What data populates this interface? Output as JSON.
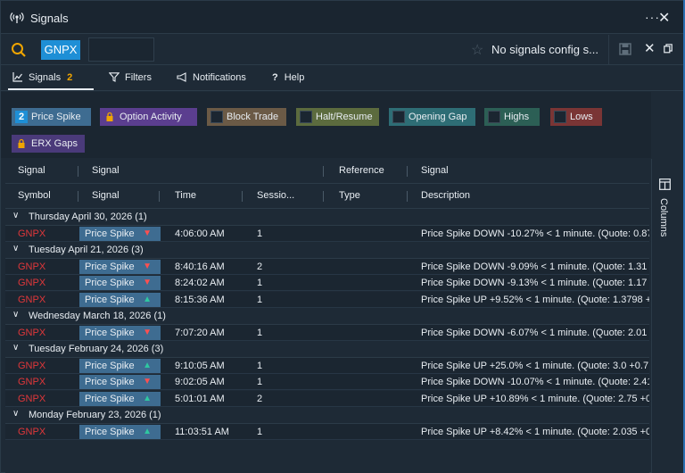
{
  "window": {
    "title": "Signals"
  },
  "search": {
    "symbol": "GNPX",
    "config_text": "No signals config s..."
  },
  "tabs": [
    {
      "label": "Signals",
      "count": "2"
    },
    {
      "label": "Filters"
    },
    {
      "label": "Notifications"
    },
    {
      "label": "Help"
    }
  ],
  "chips": [
    {
      "label": "Price Spike",
      "marker": "2",
      "bg": "#3e6c91",
      "state": "count"
    },
    {
      "label": "Option Activity",
      "bg": "#5b3e8f",
      "state": "locked"
    },
    {
      "label": "Block Trade",
      "bg": "#6b5a46",
      "state": "unchecked"
    },
    {
      "label": "Halt/Resume",
      "bg": "#5c6b3e",
      "state": "unchecked"
    },
    {
      "label": "Opening Gap",
      "bg": "#2e6d75",
      "state": "unchecked"
    },
    {
      "label": "Highs",
      "bg": "#2c5f55",
      "state": "unchecked"
    },
    {
      "label": "Lows",
      "bg": "#7a3535",
      "state": "unchecked"
    },
    {
      "label": "ERX Gaps",
      "bg": "#4a3a7a",
      "state": "locked"
    }
  ],
  "table": {
    "header_top": {
      "signal": "Signal",
      "signal2": "Signal",
      "reference": "Reference",
      "signal3": "Signal"
    },
    "header_bottom": {
      "symbol": "Symbol",
      "signal": "Signal",
      "time": "Time",
      "session": "Sessio...",
      "type": "Type",
      "description": "Description"
    },
    "groups": [
      {
        "label": "Thursday April 30, 2026 (1)",
        "rows": [
          {
            "symbol": "GNPX",
            "signal": "Price Spike",
            "dir": "down",
            "time": "4:06:00 AM",
            "session": "1",
            "description": "Price Spike DOWN -10.27% < 1 minute. (Quote: 0.87"
          }
        ]
      },
      {
        "label": "Tuesday April 21, 2026 (3)",
        "rows": [
          {
            "symbol": "GNPX",
            "signal": "Price Spike",
            "dir": "down",
            "time": "8:40:16 AM",
            "session": "2",
            "description": "Price Spike DOWN -9.09% < 1 minute. (Quote: 1.31"
          },
          {
            "symbol": "GNPX",
            "signal": "Price Spike",
            "dir": "down",
            "time": "8:24:02 AM",
            "session": "1",
            "description": "Price Spike DOWN -9.13% < 1 minute. (Quote: 1.17"
          },
          {
            "symbol": "GNPX",
            "signal": "Price Spike",
            "dir": "up",
            "time": "8:15:36 AM",
            "session": "1",
            "description": "Price Spike UP +9.52% < 1 minute. (Quote: 1.3798 +"
          }
        ]
      },
      {
        "label": "Wednesday March 18, 2026 (1)",
        "rows": [
          {
            "symbol": "GNPX",
            "signal": "Price Spike",
            "dir": "down",
            "time": "7:07:20 AM",
            "session": "1",
            "description": "Price Spike DOWN -6.07% < 1 minute. (Quote: 2.01"
          }
        ]
      },
      {
        "label": "Tuesday February 24, 2026 (3)",
        "rows": [
          {
            "symbol": "GNPX",
            "signal": "Price Spike",
            "dir": "up",
            "time": "9:10:05 AM",
            "session": "1",
            "description": "Price Spike UP +25.0% < 1 minute. (Quote: 3.0 +0.7"
          },
          {
            "symbol": "GNPX",
            "signal": "Price Spike",
            "dir": "down",
            "time": "9:02:05 AM",
            "session": "1",
            "description": "Price Spike DOWN -10.07% < 1 minute. (Quote: 2.41"
          },
          {
            "symbol": "GNPX",
            "signal": "Price Spike",
            "dir": "up",
            "time": "5:01:01 AM",
            "session": "2",
            "description": "Price Spike UP +10.89% < 1 minute. (Quote: 2.75 +0"
          }
        ]
      },
      {
        "label": "Monday February 23, 2026 (1)",
        "rows": [
          {
            "symbol": "GNPX",
            "signal": "Price Spike",
            "dir": "up",
            "time": "11:03:51 AM",
            "session": "1",
            "description": "Price Spike UP +8.42% < 1 minute. (Quote: 2.035 +0"
          }
        ]
      }
    ]
  },
  "side_panel": {
    "label": "Columns"
  }
}
